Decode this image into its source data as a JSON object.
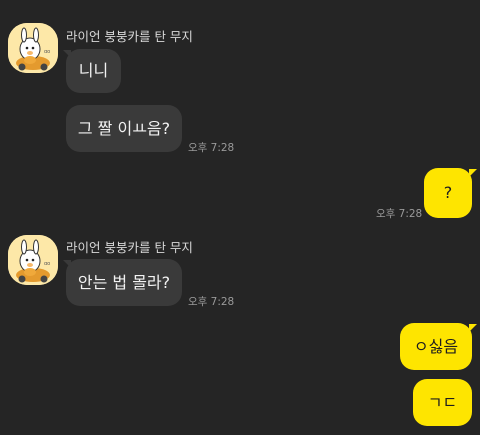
{
  "colors": {
    "background": "#252525",
    "incoming_bubble": "#3a3a3a",
    "outgoing_bubble": "#fee500",
    "avatar_bg": "#fde8a8"
  },
  "groups": [
    {
      "sender": "라이언 붕붕카를 탄 무지",
      "avatar_icon": "ryan-muzi-car-avatar-icon",
      "messages": [
        "니니",
        "그 짤 이ㅛ음?"
      ],
      "time": "오후 7:28"
    },
    {
      "sender": "라이언 붕붕카를 탄 무지",
      "avatar_icon": "ryan-muzi-car-avatar-icon",
      "messages": [
        "안는 법 몰라?"
      ],
      "time": "오후 7:28"
    }
  ],
  "outgoing": [
    {
      "text": "?",
      "time": "오후 7:28"
    },
    {
      "text": "ㅇ싫음"
    },
    {
      "text": "ㄱㄷ"
    }
  ]
}
